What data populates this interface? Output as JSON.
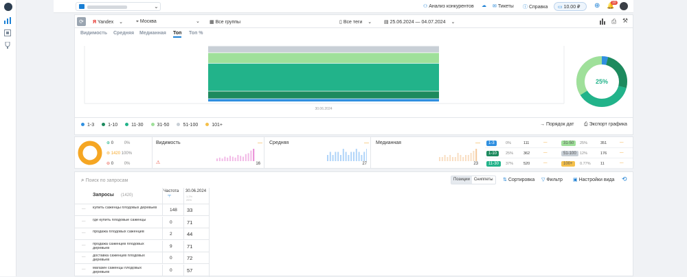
{
  "topbar": {
    "project_placeholder": "",
    "links": [
      {
        "icon": "binoculars-icon",
        "label": "Анализ конкурентов"
      },
      {
        "icon": "cloud-icon",
        "label": ""
      },
      {
        "icon": "mail-icon",
        "label": "Тикеты"
      },
      {
        "icon": "help-icon",
        "label": "Справка"
      }
    ],
    "balance": "10.00 ₽",
    "notif_count": "10"
  },
  "filters": {
    "engine": "Yandex",
    "region": "Москва",
    "groups": "Все группы",
    "tags": "Все теги",
    "dates": "25.06.2024 — 04.07.2024"
  },
  "tabs": [
    "Видимость",
    "Средняя",
    "Медианная",
    "Топ",
    "Топ %"
  ],
  "active_tab": "Топ",
  "chart": {
    "x_label": "30.06.2024",
    "donut_label": "25%",
    "legend": [
      {
        "label": "1-3",
        "color": "#2f8fe0"
      },
      {
        "label": "1-10",
        "color": "#1d8a5e"
      },
      {
        "label": "11-30",
        "color": "#22b38a"
      },
      {
        "label": "31-50",
        "color": "#9fe09a"
      },
      {
        "label": "51-100",
        "color": "#c8cfd6"
      },
      {
        "label": "101+",
        "color": "#f5c04a"
      }
    ],
    "order_dates": "Порядок дат",
    "export": "Экспорт графика"
  },
  "chart_data": {
    "type": "bar",
    "categories": [
      "30.06.2024"
    ],
    "series": [
      {
        "name": "1-3",
        "values": [
          4
        ]
      },
      {
        "name": "1-10",
        "values": [
          10
        ]
      },
      {
        "name": "11-30",
        "values": [
          37
        ]
      },
      {
        "name": "31-50",
        "values": [
          14
        ]
      },
      {
        "name": "51-100",
        "values": [
          9
        ]
      }
    ],
    "donut": {
      "label": "25%",
      "values": [
        4,
        25,
        37,
        34
      ]
    }
  },
  "summary": {
    "counts": [
      {
        "value": "0",
        "pct": "0%",
        "color": "#22b38a"
      },
      {
        "value": "1420",
        "pct": "100%",
        "color": "#f5a623"
      },
      {
        "value": "0",
        "pct": "0%",
        "color": "#e74c3c"
      }
    ],
    "metrics": [
      {
        "title": "Видимость",
        "value": "16",
        "color": "#e98ad6"
      },
      {
        "title": "Средняя",
        "value": "27",
        "color": "#7ab8f5"
      },
      {
        "title": "Медианная",
        "value": "23",
        "color": "#f5c89a"
      }
    ],
    "top_table": [
      {
        "range": "1-3",
        "pct": "0%",
        "count": "111",
        "color": "#2f8fe0",
        "range2": "31-50",
        "pct2": "25%",
        "count2": "351",
        "color2": "#9fe09a"
      },
      {
        "range": "1-10",
        "pct": "25%",
        "count": "362",
        "color": "#1d8a5e",
        "range2": "51-100",
        "pct2": "12%",
        "count2": "176",
        "color2": "#c8cfd6"
      },
      {
        "range": "11-30",
        "pct": "37%",
        "count": "520",
        "color": "#22b38a",
        "range2": "100+",
        "pct2": "0.77%",
        "count2": "11",
        "color2": "#f5c04a"
      }
    ]
  },
  "queries": {
    "search_placeholder": "Поиск по запросам",
    "view_tabs": [
      "Позиции",
      "Сниппеты"
    ],
    "sort": "Сортировка",
    "filter": "Фильтр",
    "view_settings": "Настройки вида",
    "header": {
      "title": "Запросы",
      "count": "(1420)",
      "freq": "Частота",
      "freq_sub": "\"!\"",
      "date": "30.06.2024",
      "date_sub1": "1.2%",
      "date_sub2": "25%"
    },
    "rows": [
      {
        "query": "купить саженцы плодовых деревьев",
        "freq": "148",
        "pos": "33"
      },
      {
        "query": "где купить плодовые саженцы",
        "freq": "0",
        "pos": "71"
      },
      {
        "query": "продажа плодовых саженцев",
        "freq": "2",
        "pos": "44"
      },
      {
        "query": "продажа саженцев плодовых деревьев",
        "freq": "9",
        "pos": "71"
      },
      {
        "query": "доставка саженцев плодовых деревьев",
        "freq": "0",
        "pos": "72"
      },
      {
        "query": "магазин саженцы плодовых деревьев",
        "freq": "0",
        "pos": "57"
      }
    ]
  }
}
